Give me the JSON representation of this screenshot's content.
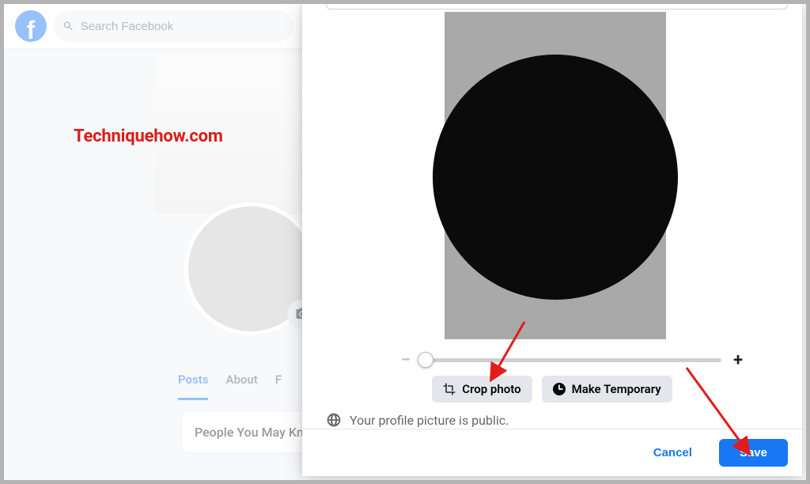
{
  "header": {
    "search_placeholder": "Search Facebook"
  },
  "watermark": "Techniquehow.com",
  "profile": {
    "tabs": [
      "Posts",
      "About",
      "F"
    ],
    "suggestion_title": "People You May Kn"
  },
  "modal": {
    "zoom": {
      "minus": "−",
      "plus": "+"
    },
    "crop_label": "Crop photo",
    "temp_label": "Make Temporary",
    "public_notice": "Your profile picture is public.",
    "cancel_label": "Cancel",
    "save_label": "Save"
  }
}
